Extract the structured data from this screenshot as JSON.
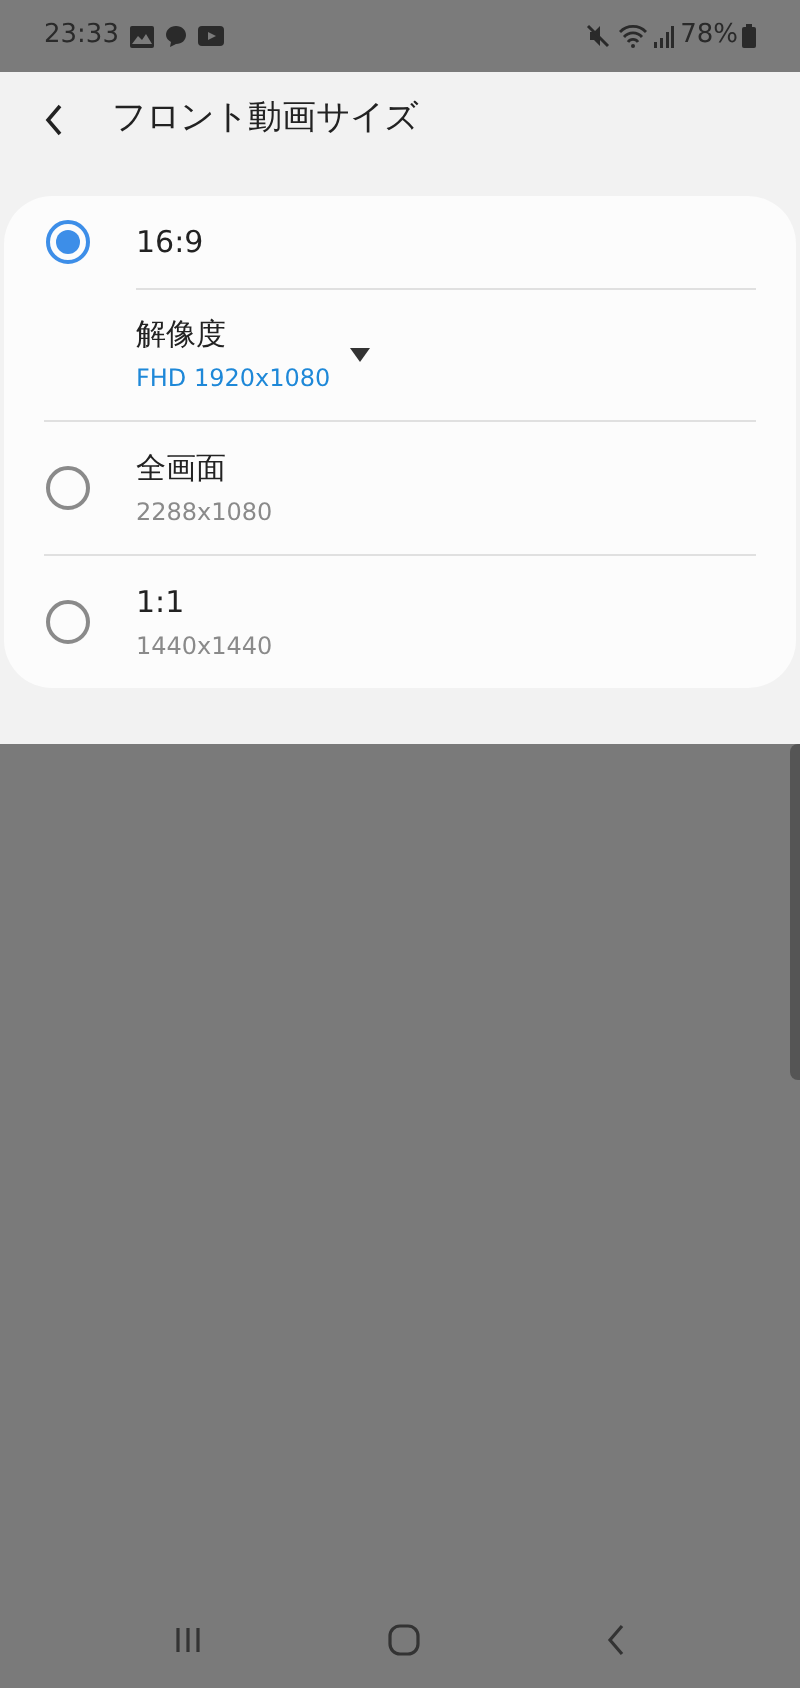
{
  "status_bar": {
    "time": "23:33",
    "battery": "78%"
  },
  "header": {
    "title": "フロント動画サイズ"
  },
  "options": [
    {
      "label": "16:9",
      "selected": true,
      "setting": {
        "label": "解像度",
        "value": "FHD 1920x1080"
      }
    },
    {
      "label": "全画面",
      "selected": false,
      "detail": "2288x1080"
    },
    {
      "label": "1:1",
      "selected": false,
      "detail": "1440x1440"
    }
  ]
}
